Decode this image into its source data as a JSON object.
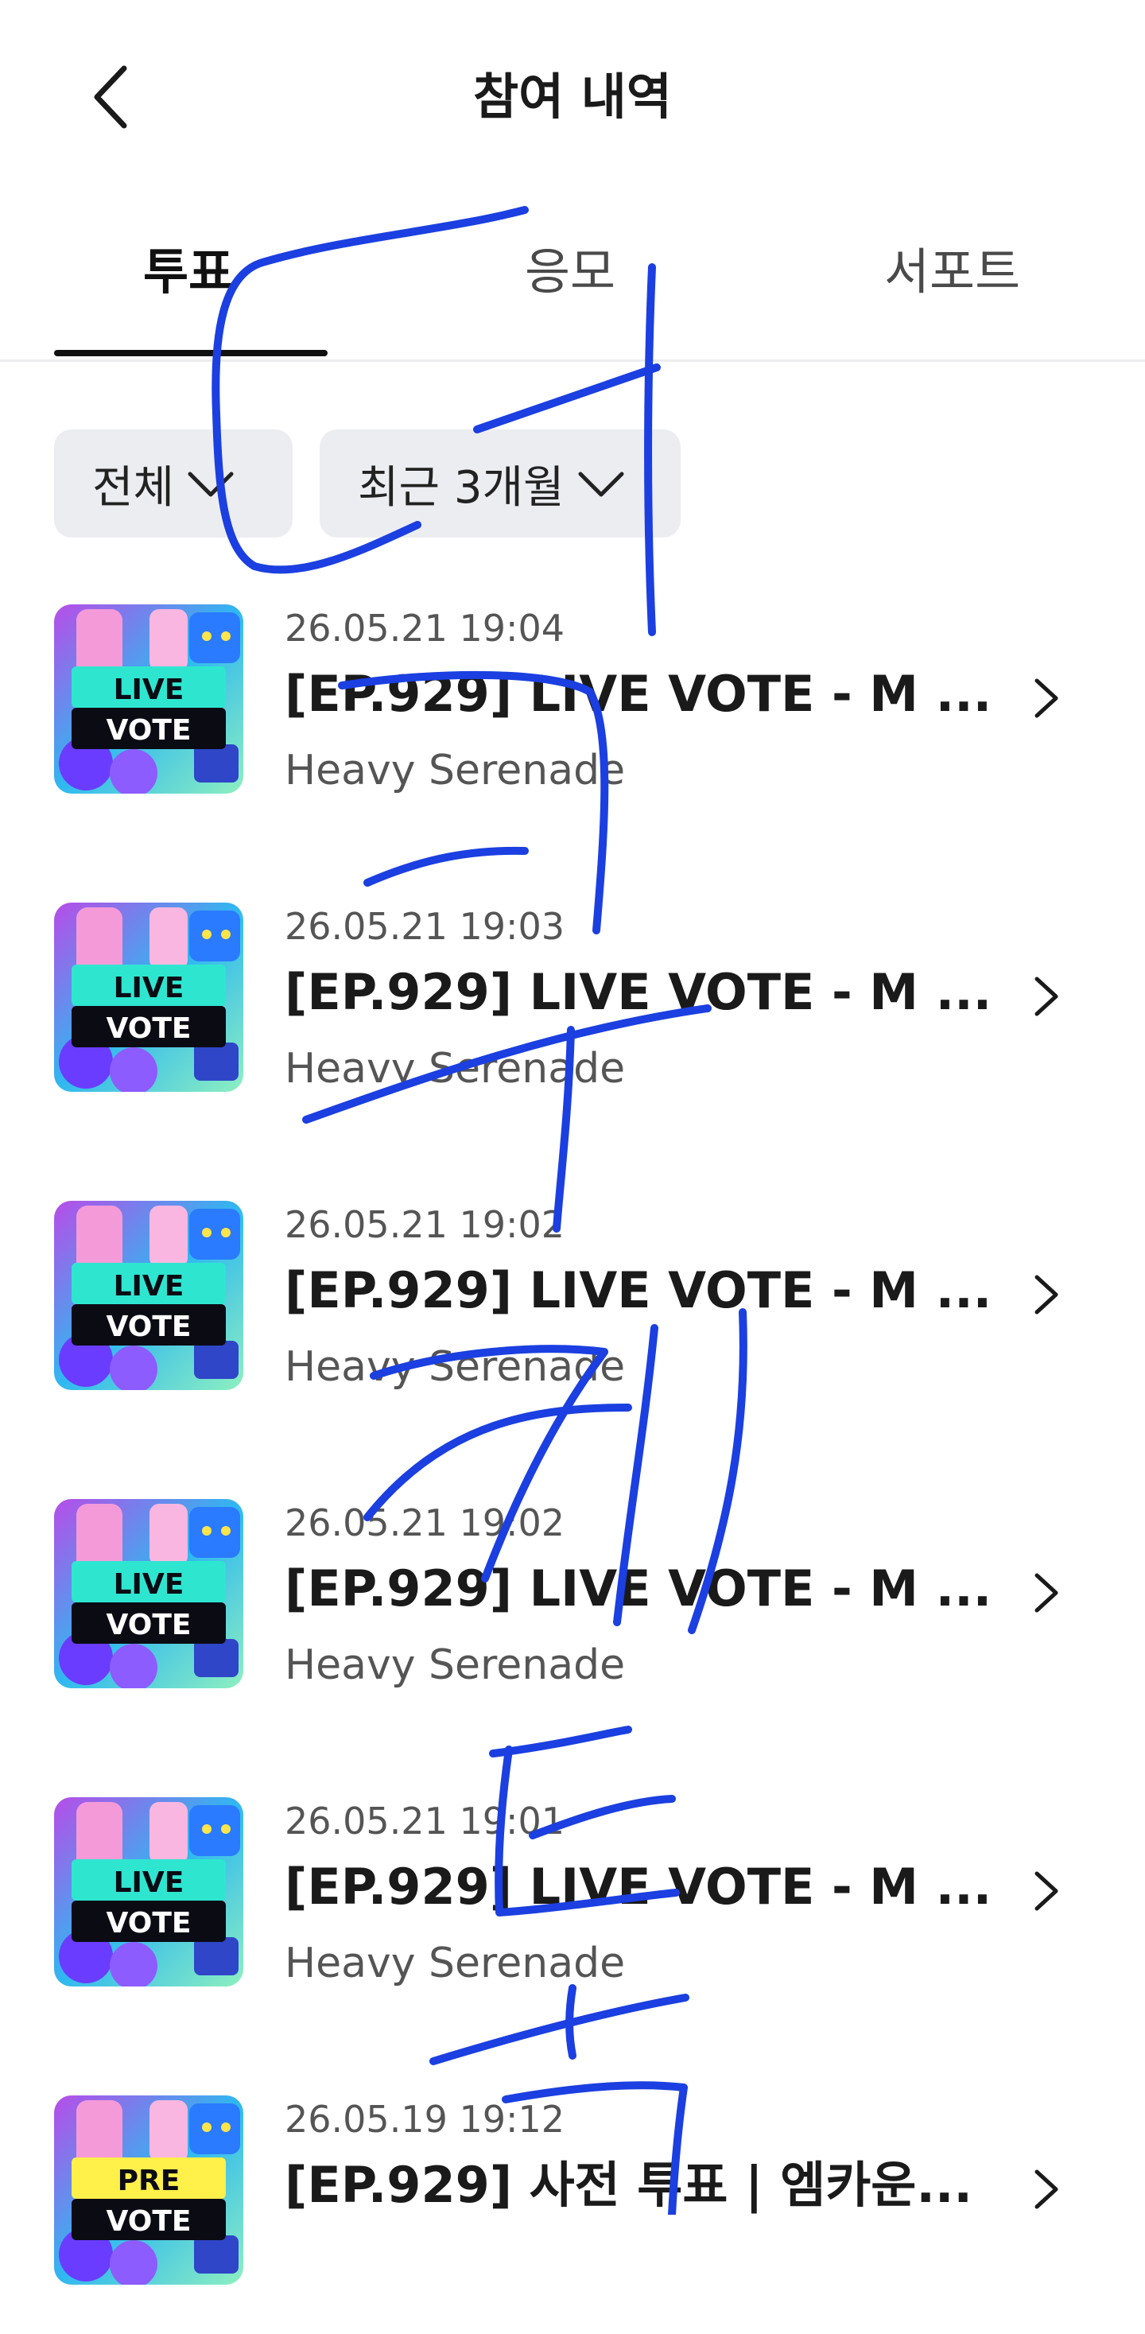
{
  "header": {
    "title": "참여 내역"
  },
  "tabs": [
    {
      "label": "투표",
      "active": true
    },
    {
      "label": "응모",
      "active": false
    },
    {
      "label": "서포트",
      "active": false
    }
  ],
  "filters": [
    {
      "label": "전체"
    },
    {
      "label": "최근 3개월"
    }
  ],
  "items": [
    {
      "date": "26.05.21 19:04",
      "title": "[EP.929] LIVE VOTE - M ...",
      "subtitle": "Heavy Serenade",
      "badge_top": "LIVE",
      "badge_bottom": "VOTE"
    },
    {
      "date": "26.05.21 19:03",
      "title": "[EP.929] LIVE VOTE - M ...",
      "subtitle": "Heavy Serenade",
      "badge_top": "LIVE",
      "badge_bottom": "VOTE"
    },
    {
      "date": "26.05.21 19:02",
      "title": "[EP.929] LIVE VOTE - M ...",
      "subtitle": "Heavy Serenade",
      "badge_top": "LIVE",
      "badge_bottom": "VOTE"
    },
    {
      "date": "26.05.21 19:02",
      "title": "[EP.929] LIVE VOTE - M ...",
      "subtitle": "Heavy Serenade",
      "badge_top": "LIVE",
      "badge_bottom": "VOTE"
    },
    {
      "date": "26.05.21 19:01",
      "title": "[EP.929] LIVE VOTE - M ...",
      "subtitle": "Heavy Serenade",
      "badge_top": "LIVE",
      "badge_bottom": "VOTE"
    },
    {
      "date": "26.05.19 19:12",
      "title": "[EP.929] 사전 투표 | 엠카운...",
      "subtitle": "",
      "badge_top": "PRE",
      "badge_bottom": "VOTE"
    }
  ],
  "colors": {
    "annotation_ink": "#1b3fe0",
    "filter_bg": "#ecedf1",
    "live_badge": "#2ee6d0",
    "pre_badge": "#fff04a"
  },
  "icons": [
    "back-arrow-icon",
    "chevron-down-icon",
    "chevron-right-icon"
  ]
}
